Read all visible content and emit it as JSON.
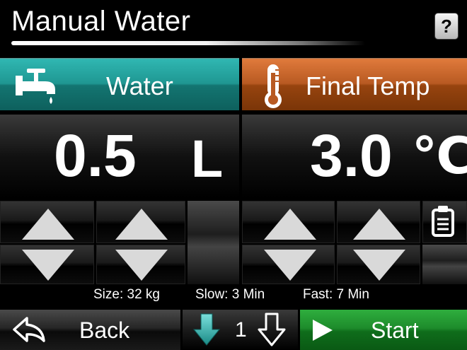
{
  "title": "Manual Water",
  "help_label": "?",
  "water": {
    "label": "Water",
    "value": "0.5",
    "unit": "L",
    "icon": "faucet-icon"
  },
  "final_temp": {
    "label": "Final Temp",
    "value": "3.0",
    "unit": "℃",
    "icon": "thermometer-icon"
  },
  "info": {
    "size": "Size: 32 kg",
    "slow": "Slow: 3 Min",
    "fast": "Fast: 7 Min"
  },
  "footer": {
    "back_label": "Back",
    "page_number": "1",
    "start_label": "Start"
  },
  "colors": {
    "water_header": "#1f9792",
    "temp_header": "#b85a22",
    "start_button": "#1d8b2b"
  },
  "icons": [
    "faucet-icon",
    "thermometer-icon",
    "clipboard-icon",
    "back-arrow-icon",
    "page-down-icon",
    "page-down-outline-icon",
    "play-icon"
  ]
}
